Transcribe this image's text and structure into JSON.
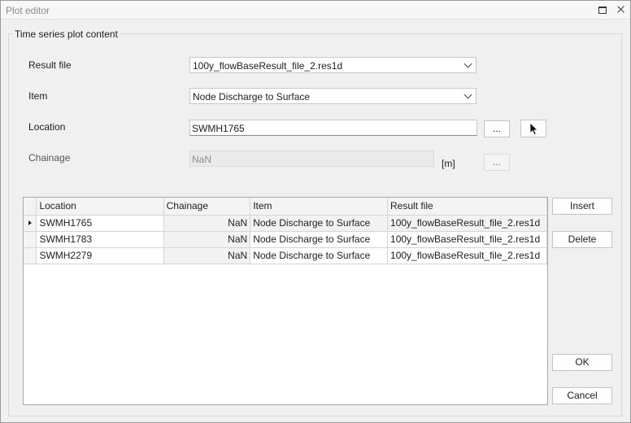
{
  "window": {
    "title": "Plot editor"
  },
  "group": {
    "legend": "Time series plot content"
  },
  "form": {
    "result_file": {
      "label": "Result file",
      "value": "100y_flowBaseResult_file_2.res1d"
    },
    "item": {
      "label": "Item",
      "value": "Node Discharge to Surface"
    },
    "location": {
      "label": "Location",
      "value": "SWMH1765",
      "browse_label": "..."
    },
    "chainage": {
      "label": "Chainage",
      "value": "NaN",
      "unit": "[m]",
      "browse_label": "..."
    }
  },
  "grid": {
    "columns": [
      "Location",
      "Chainage",
      "Item",
      "Result file"
    ],
    "rows": [
      [
        "SWMH1765",
        "NaN",
        "Node Discharge to Surface",
        "100y_flowBaseResult_file_2.res1d"
      ],
      [
        "SWMH1783",
        "NaN",
        "Node Discharge to Surface",
        "100y_flowBaseResult_file_2.res1d"
      ],
      [
        "SWMH2279",
        "NaN",
        "Node Discharge to Surface",
        "100y_flowBaseResult_file_2.res1d"
      ]
    ]
  },
  "buttons": {
    "insert": "Insert",
    "delete": "Delete",
    "ok": "OK",
    "cancel": "Cancel"
  },
  "icons": {
    "maximize": "maximize-icon",
    "close": "close-icon",
    "pick": "cursor-pointer-icon",
    "row_pointer": "row-pointer-icon"
  }
}
